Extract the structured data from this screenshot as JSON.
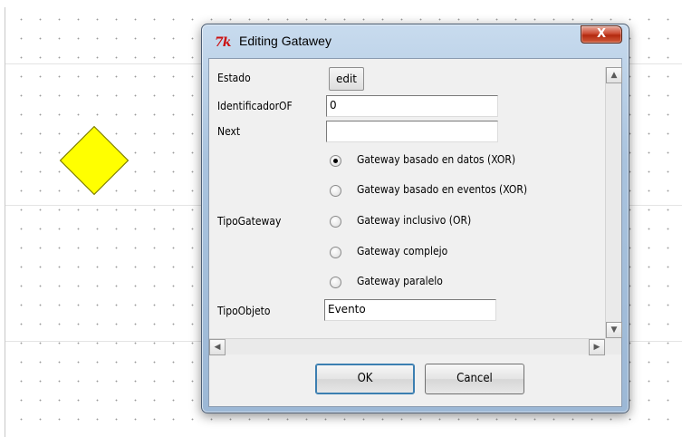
{
  "window": {
    "title": "Editing Gatawey",
    "close_glyph": "X",
    "app_icon_glyph": "7k"
  },
  "form": {
    "estado_label": "Estado",
    "edit_label": "edit",
    "identificador_label": "IdentificadorOF",
    "identificador_value": "0",
    "next_label": "Next",
    "next_value": "",
    "tipo_gateway_label": "TipoGateway",
    "tipo_gateway_options": [
      "Gateway basado en datos (XOR)",
      "Gateway basado en eventos (XOR)",
      "Gateway inclusivo (OR)",
      "Gateway complejo",
      "Gateway paralelo"
    ],
    "tipo_gateway_selected": "Gateway basado en datos (XOR)",
    "tipo_objeto_label": "TipoObjeto",
    "tipo_objeto_value": "Evento"
  },
  "buttons": {
    "ok_label": "OK",
    "cancel_label": "Cancel"
  },
  "colors": {
    "diamond_fill": "#ffff00",
    "close_button": "#c8402a"
  },
  "icons": {
    "scroll_up": "up-arrow-icon",
    "scroll_down": "down-arrow-icon",
    "scroll_left": "left-arrow-icon",
    "scroll_right": "right-arrow-icon"
  }
}
